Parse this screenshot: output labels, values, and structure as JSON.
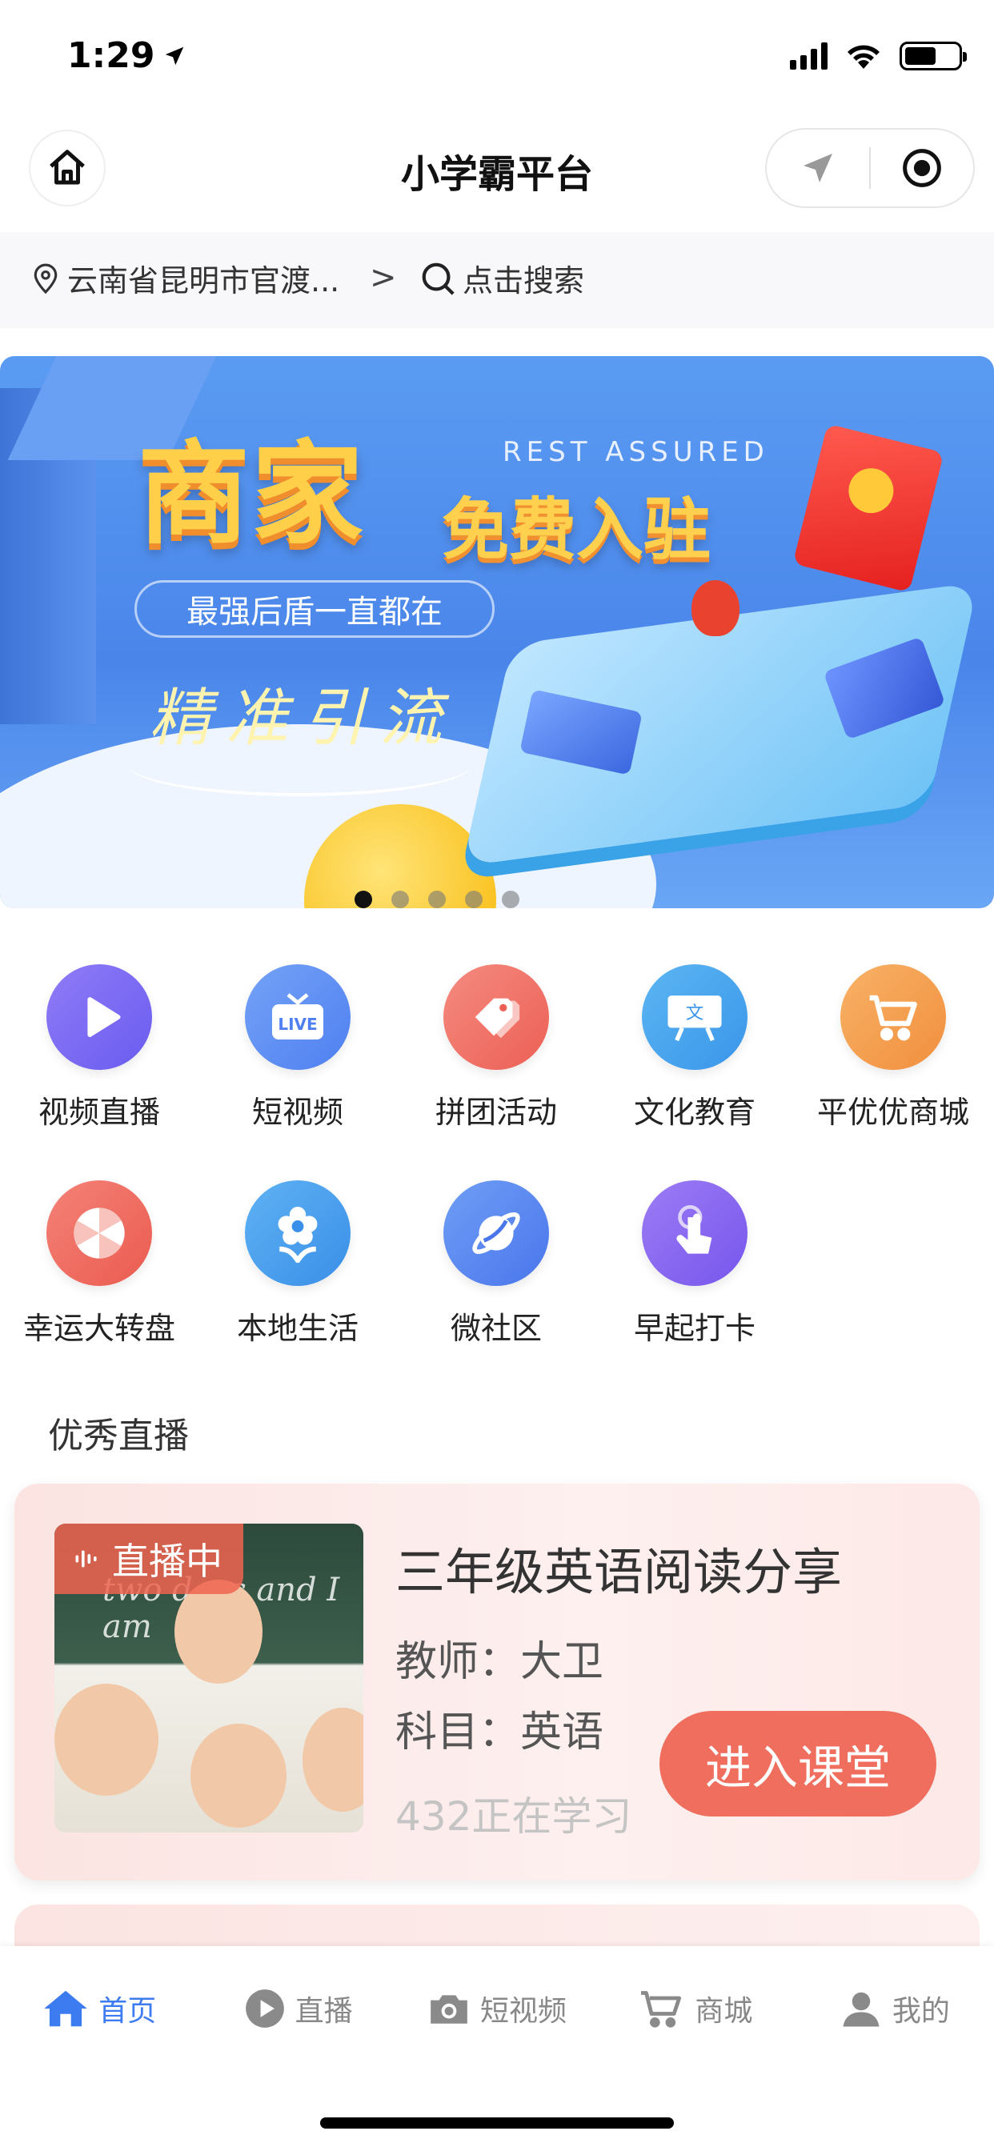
{
  "status": {
    "time": "1:29"
  },
  "nav": {
    "title": "小学霸平台"
  },
  "location": {
    "text": "云南省昆明市官渡...",
    "chevron": ">"
  },
  "search": {
    "placeholder": "点击搜索"
  },
  "banner": {
    "title": "商家",
    "subtitle_en": "REST ASSURED",
    "title2": "免费入驻",
    "tagline": "最强后盾一直都在",
    "script": "精准引流",
    "pages": 5,
    "active_page": 1
  },
  "grid": {
    "row1": [
      {
        "label": "视频直播",
        "icon": "play-icon",
        "color": "#7b6cf5"
      },
      {
        "label": "短视频",
        "icon": "live-tv-icon",
        "color": "#5c8ff3"
      },
      {
        "label": "拼团活动",
        "icon": "tag-icon",
        "color": "#f0746a"
      },
      {
        "label": "文化教育",
        "icon": "blackboard-icon",
        "color": "#4aa6ee"
      },
      {
        "label": "平优优商城",
        "icon": "cart-icon",
        "color": "#f4a052"
      }
    ],
    "row2": [
      {
        "label": "幸运大转盘",
        "icon": "wheel-icon",
        "color": "#ef6e63"
      },
      {
        "label": "本地生活",
        "icon": "flower-icon",
        "color": "#4ba4ec"
      },
      {
        "label": "微社区",
        "icon": "planet-icon",
        "color": "#5d8df2"
      },
      {
        "label": "早起打卡",
        "icon": "tap-hand-icon",
        "color": "#8d6cf0"
      }
    ]
  },
  "section": {
    "title": "优秀直播"
  },
  "live": {
    "badge": "直播中",
    "board_text": "two days and I am",
    "title": "三年级英语阅读分享",
    "teacher": "教师：大卫",
    "subject": "科目：英语",
    "count": "432正在学习",
    "button": "进入课堂"
  },
  "tabs": [
    {
      "label": "首页",
      "icon": "home-icon",
      "active": true
    },
    {
      "label": "直播",
      "icon": "play-circle-icon",
      "active": false
    },
    {
      "label": "短视频",
      "icon": "camera-icon",
      "active": false
    },
    {
      "label": "商城",
      "icon": "cart-icon",
      "active": false
    },
    {
      "label": "我的",
      "icon": "user-icon",
      "active": false
    }
  ],
  "colors": {
    "accent": "#3d7bf0",
    "button": "#ef6e5e"
  }
}
